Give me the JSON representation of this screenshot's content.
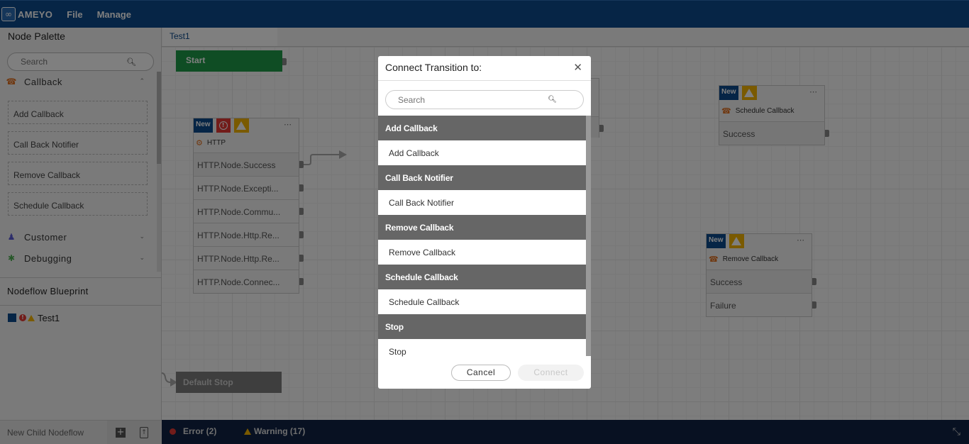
{
  "app": {
    "logo_text": "AMEYO",
    "menu": [
      "File",
      "Manage"
    ]
  },
  "sidebar": {
    "palette_title": "Node Palette",
    "search_placeholder": "Search",
    "categories": [
      {
        "label": "Callback",
        "icon": "phone-callback-icon",
        "expanded": true,
        "items": [
          "Add Callback",
          "Call Back Notifier",
          "Remove Callback",
          "Schedule Callback"
        ]
      },
      {
        "label": "Customer",
        "icon": "users-icon",
        "expanded": false
      },
      {
        "label": "Debugging",
        "icon": "bug-icon",
        "expanded": false
      }
    ],
    "blueprint_title": "Nodeflow Blueprint",
    "blueprint_items": [
      {
        "label": "Test1",
        "has_error": true,
        "has_warning": true
      }
    ],
    "footer_label": "New Child Nodeflow"
  },
  "tabs": [
    {
      "label": "Test1",
      "active": true
    }
  ],
  "canvas": {
    "start_label": "Start",
    "stop_label": "Default Stop",
    "nodes": [
      {
        "name": "http",
        "badge": "New",
        "has_error": true,
        "has_warning": true,
        "title": "HTTP",
        "rows": [
          "HTTP.Node.Success",
          "HTTP.Node.Excepti...",
          "HTTP.Node.Commu...",
          "HTTP.Node.Http.Re...",
          "HTTP.Node.Http.Re...",
          "HTTP.Node.Connec..."
        ]
      },
      {
        "name": "schedule-callback",
        "badge": "New",
        "has_error": false,
        "has_warning": true,
        "title": "Schedule Callback",
        "rows": [
          "Success"
        ]
      },
      {
        "name": "remove-callback",
        "badge": "New",
        "has_error": false,
        "has_warning": true,
        "title": "Remove Callback",
        "rows": [
          "Success",
          "Failure"
        ]
      }
    ]
  },
  "status": {
    "error_label": "Error (2)",
    "warning_label": "Warning (17)"
  },
  "modal": {
    "title": "Connect Transition to:",
    "search_placeholder": "Search",
    "groups": [
      {
        "header": "Add Callback",
        "items": [
          "Add Callback"
        ]
      },
      {
        "header": "Call Back Notifier",
        "items": [
          "Call Back Notifier"
        ]
      },
      {
        "header": "Remove Callback",
        "items": [
          "Remove Callback"
        ]
      },
      {
        "header": "Schedule Callback",
        "items": [
          "Schedule Callback"
        ]
      },
      {
        "header": "Stop",
        "items": [
          "Stop"
        ]
      }
    ],
    "cancel_label": "Cancel",
    "connect_label": "Connect",
    "connect_enabled": false
  }
}
